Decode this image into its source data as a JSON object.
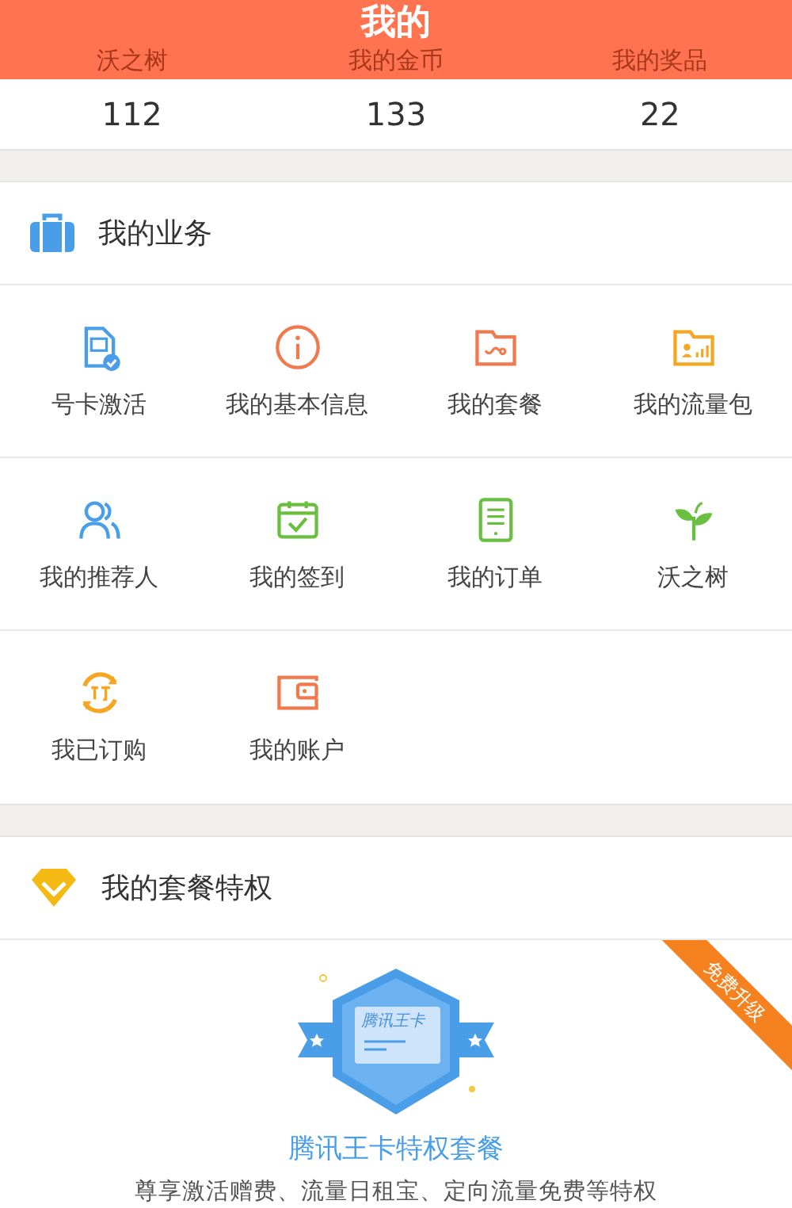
{
  "header": {
    "title": "我的"
  },
  "stats": [
    {
      "label": "沃之树",
      "value": "112"
    },
    {
      "label": "我的金币",
      "value": "133"
    },
    {
      "label": "我的奖品",
      "value": "22"
    }
  ],
  "business": {
    "title": "我的业务",
    "items": [
      {
        "label": "号卡激活"
      },
      {
        "label": "我的基本信息"
      },
      {
        "label": "我的套餐"
      },
      {
        "label": "我的流量包"
      },
      {
        "label": "我的推荐人"
      },
      {
        "label": "我的签到"
      },
      {
        "label": "我的订单"
      },
      {
        "label": "沃之树"
      },
      {
        "label": "我已订购"
      },
      {
        "label": "我的账户"
      }
    ]
  },
  "privilege": {
    "title": "我的套餐特权",
    "ribbon": "免费升级",
    "card_text": "腾讯王卡",
    "name": "腾讯王卡特权套餐",
    "description": "尊享激活赠费、流量日租宝、定向流量免费等特权"
  }
}
